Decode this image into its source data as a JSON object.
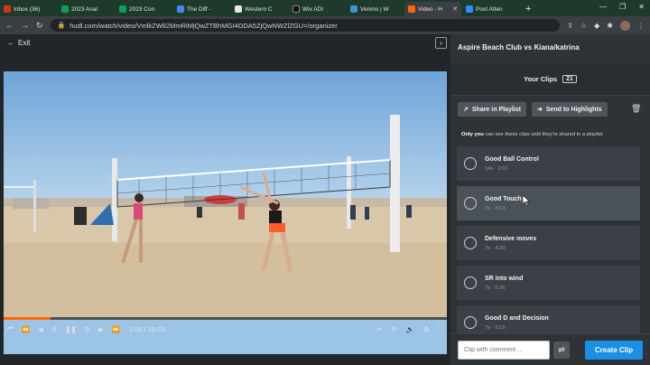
{
  "browser": {
    "tabs": [
      {
        "label": "Inbox (36)",
        "color": "#d93025"
      },
      {
        "label": "2023 Anal",
        "color": "#0f9d58"
      },
      {
        "label": "2023 Con",
        "color": "#0f9d58"
      },
      {
        "label": "The Diff -",
        "color": "#4285f4"
      },
      {
        "label": "Western C",
        "color": "#e8e8e8"
      },
      {
        "label": "Wix ADI",
        "color": "#111111"
      },
      {
        "label": "Venmo | W",
        "color": "#3d95ce"
      },
      {
        "label": "Video - H",
        "color": "#ff6600"
      },
      {
        "label": "Post Atten",
        "color": "#2d8cff"
      }
    ],
    "url": "hudl.com/watch/video/VmlkZW82MmRiMjQwZTBhMGI4ODA5ZjQwNWZlZGU=/organizer"
  },
  "player": {
    "exit_label": "Exit",
    "time": "2:03 / 19:23",
    "progress": 0.105
  },
  "panel": {
    "title": "Aspire Beach Club vs Kiana/katrina",
    "your_clips": "Your Clips",
    "clip_count": "21",
    "share_label": "Share in Playlist",
    "highlights_label": "Send to Highlights",
    "note_bold": "Only you",
    "note_rest": " can see these clips until they're shared in a playlist.",
    "clips": [
      {
        "name": "Good Ball Control",
        "meta": "14s · 2:01"
      },
      {
        "name": "Good Touch",
        "meta": "7s · 4:13"
      },
      {
        "name": "Defensive moves",
        "meta": "7s · 4:30"
      },
      {
        "name": "SR into wind",
        "meta": "7s · 5:36"
      },
      {
        "name": "Good D and Decision",
        "meta": "7s · 9:19"
      }
    ],
    "comment_placeholder": "Clip with comment ...",
    "create_label": "Create Clip"
  }
}
